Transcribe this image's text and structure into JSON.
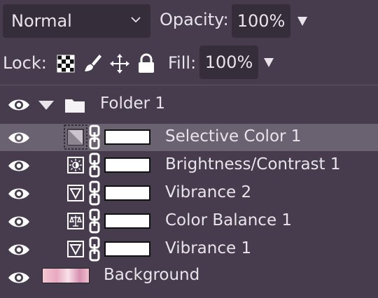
{
  "toolbar": {
    "blend_mode": "Normal",
    "opacity_label": "Opacity:",
    "opacity_value": "100%",
    "lock_label": "Lock:",
    "lock_icons": [
      "lock-transparency-icon",
      "lock-paint-icon",
      "lock-position-icon",
      "lock-all-icon"
    ],
    "fill_label": "Fill:",
    "fill_value": "100%"
  },
  "layers": {
    "folder": {
      "name": "Folder 1",
      "expanded": true
    },
    "items": [
      {
        "name": "Selective Color 1",
        "icon": "selective-color-icon",
        "selected": true
      },
      {
        "name": "Brightness/Contrast 1",
        "icon": "brightness-contrast-icon",
        "selected": false
      },
      {
        "name": "Vibrance 2",
        "icon": "vibrance-icon",
        "selected": false
      },
      {
        "name": "Color Balance 1",
        "icon": "color-balance-icon",
        "selected": false
      },
      {
        "name": "Vibrance 1",
        "icon": "vibrance-icon",
        "selected": false
      }
    ],
    "background": {
      "name": "Background"
    }
  },
  "colors": {
    "panel_bg": "#463c4d",
    "field_bg": "#352d3a",
    "selected_row": "#6b6271",
    "text": "#e8e4ea"
  }
}
